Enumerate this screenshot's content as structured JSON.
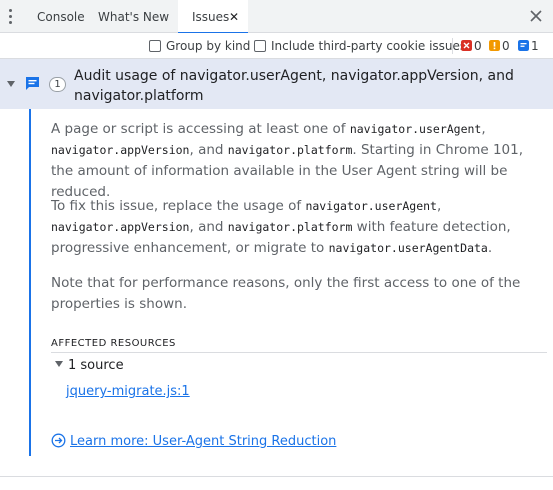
{
  "tabs": {
    "console": "Console",
    "whats_new": "What's New",
    "issues": "Issues",
    "issues_close": "✕"
  },
  "toolbar": {
    "group_by_kind": "Group by kind",
    "include_third_party": "Include third-party cookie issues",
    "error_count": "0",
    "warning_count": "0",
    "info_count": "1"
  },
  "issue": {
    "count": "1",
    "title": "Audit usage of navigator.userAgent, navigator.appVersion, and navigator.platform",
    "p1": {
      "t1": "A page or script is accessing at least one of ",
      "c1": "navigator.userAgent",
      "t2": ", ",
      "c2": "navigator.appVersion",
      "t3": ", and ",
      "c3": "navigator.platform",
      "t4": ". Starting in Chrome 101, the amount of information available in the User Agent string will be reduced."
    },
    "p2": {
      "t1": "To fix this issue, replace the usage of ",
      "c1": "navigator.userAgent",
      "t2": ", ",
      "c2": "navigator.appVersion",
      "t3": ", and ",
      "c3": "navigator.platform",
      "t4": " with feature detection, progressive enhancement, or migrate to ",
      "c4": "navigator.userAgentData",
      "t5": "."
    },
    "p3": "Note that for performance reasons, only the first access to one of the properties is shown.",
    "affected_label": "AFFECTED RESOURCES",
    "source_summary": "1 source",
    "source_link": "jquery-migrate.js:1",
    "learn_more": "Learn more: User-Agent String Reduction"
  },
  "colors": {
    "accent": "#1a73e8",
    "error": "#d93025",
    "warning": "#f29900",
    "info": "#1a73e8",
    "header_bg": "#e3e8f4"
  },
  "icons": {
    "menu": "kebab-menu-icon",
    "close": "close-icon",
    "issue": "chat-bubble-icon",
    "learn_more": "arrow-circle-icon"
  }
}
